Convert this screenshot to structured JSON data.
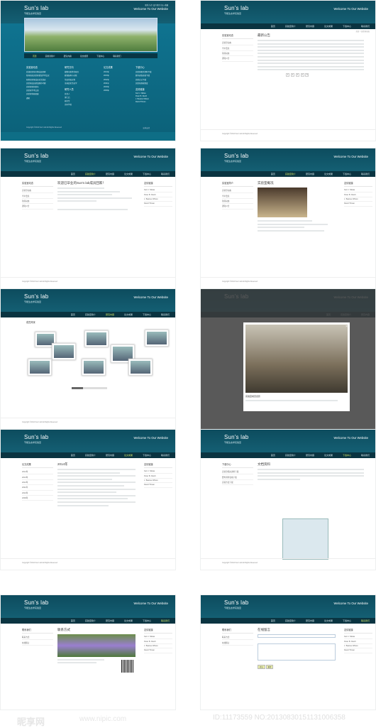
{
  "header": {
    "logo": "Sun's lab",
    "logo_sub": "节能生态学实验室",
    "welcome": "Welcome To Our Website",
    "slogan": "We study plant and animal traits and links to community structuring and ecosystem functioning.",
    "tiny_top": "联系方式 | 设为首页 | 加入收藏"
  },
  "nav": [
    "首页",
    "实验室简介",
    "研究内容",
    "论文成果",
    "下载中心",
    "联系我们"
  ],
  "home": {
    "col1_title": "实验室动态",
    "col1_items": [
      "欢迎实验室全体成员回家",
      "新闻动态实验室参加学术会议",
      "祝贺实验室成员论文发表",
      "实验室成员参加野外考察",
      "实验室新闻发布",
      "实验室学术交流",
      "实验室科研进展",
      "通知"
    ],
    "col2_title": "研究方向",
    "col2_items": [
      "植物功能性状研究",
      "群落结构与功能",
      "生态系统过程",
      "全球变化生态学"
    ],
    "col2b_title": "研究人员",
    "col2b_items": [
      "负责人",
      "博士后",
      "研究生",
      "访问学者"
    ],
    "col3_title": "论文成果",
    "col3_items": [
      "2014年",
      "2013年",
      "2012年",
      "2011年",
      "2010年",
      "2009年"
    ],
    "col4_title": "下载中心",
    "col4_items": [
      "实验室相关资料下载",
      "野外调查表格下载",
      "实验方法下载",
      "实验室规章制度"
    ],
    "col4b_title": "友情链接",
    "col4b_items": [
      "Karl J. Niklas",
      "Peter B. Reich",
      "J. Bastow Wilson",
      "David Tilman"
    ],
    "footer": "Copyright ©2014 Sun's lab All Rights Reserved",
    "footer_right": "技术支持"
  },
  "sidebar_titles": {
    "news": "实验室动态",
    "about": "实验室简介",
    "paper": "论文成果",
    "download": "下载中心",
    "contact": "联系我们"
  },
  "sidebar_items": [
    "实验室动态",
    "学术会议",
    "新闻动态",
    "通知公告"
  ],
  "links_title": "友情链接",
  "links": [
    "Karl J. Niklas",
    "Peter B. Reich",
    "J. Bastow Wilson",
    "David Tilman"
  ],
  "pages": {
    "notice_title": "最新公告",
    "welcome_title": "欢迎已毕业的Sun's lab成员回家！",
    "about_title": "实验室概况",
    "gallery_title": "成员风采",
    "lightbox_caption": "实验室成员合影",
    "paper_title": "2014年",
    "download_title": "文档资料",
    "contact_title": "联系方式",
    "message_title": "在线留言",
    "submit": "提交",
    "reset": "重置",
    "pager": [
      "1",
      "2",
      "3",
      "4",
      "5"
    ],
    "breadcrumb": "首页 > 实验室动态"
  },
  "watermark": {
    "logo": "昵享网",
    "url": "www.nipic.com",
    "id": "ID:11173559 NO:20130830151131006358"
  }
}
